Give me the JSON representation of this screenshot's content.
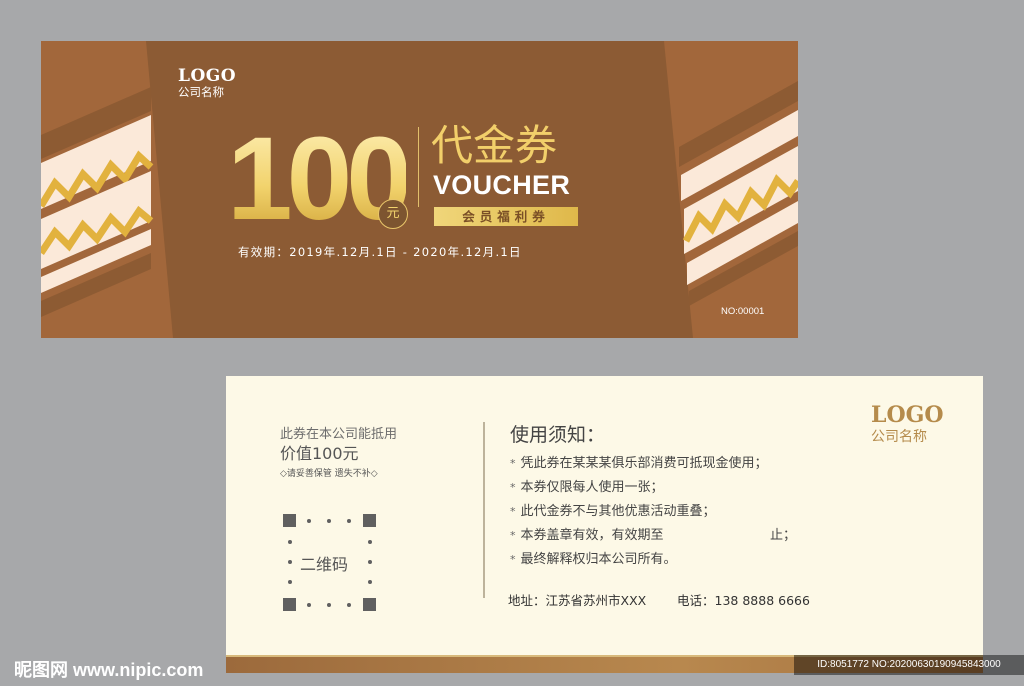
{
  "front": {
    "logo": "LOGO",
    "company": "公司名称",
    "amount": "100",
    "currency": "元",
    "title_cn": "代金券",
    "title_en": "VOUCHER",
    "member_tag": "会员福利券",
    "validity": "有效期：2019年.12月.1日 - 2020年.12月.1日",
    "serial": "NO:00001",
    "colors": {
      "card": "#a2673b",
      "panel": "#8c5b34",
      "gold": "#f2cf6a",
      "cream": "#fbe9d9",
      "zigzag": "#e2b23e"
    }
  },
  "back": {
    "usage": "此券在本公司能抵用",
    "value": "价值100元",
    "keep_note": "◇请妥善保管 遗失不补◇",
    "qr_label": "二维码",
    "notice_title": "使用须知：",
    "notices": [
      "凭此券在某某某俱乐部消费可抵现金使用；",
      "本券仅限每人使用一张；",
      "此代金券不与其他优惠活动重叠；",
      "本券盖章有效，有效期至",
      "最终解释权归本公司所有。"
    ],
    "notice_end": "止；",
    "address": "地址：江苏省苏州市XXX",
    "phone": "电话：138 8888 6666",
    "logo": "LOGO",
    "company": "公司名称"
  },
  "watermark": {
    "site": "昵图网 www.nipic.com",
    "id": "ID:8051772 NO:20200630190945843000"
  }
}
